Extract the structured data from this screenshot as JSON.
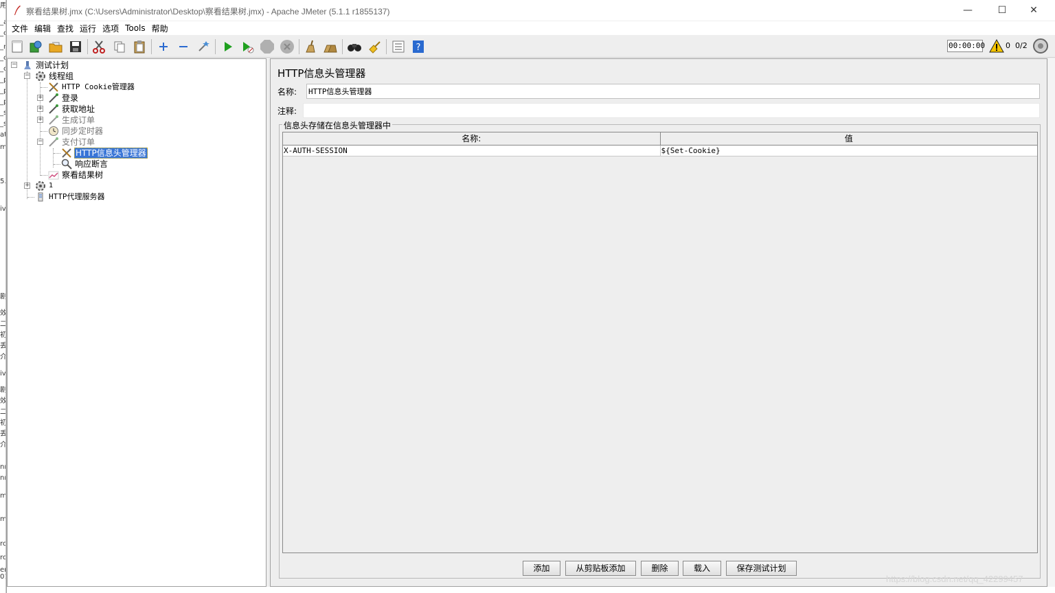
{
  "window": {
    "title": "察看结果树.jmx (C:\\Users\\Administrator\\Desktop\\察看结果树.jmx) - Apache JMeter (5.1.1 r1855137)",
    "minimize": "—",
    "maximize": "☐",
    "close": "✕"
  },
  "menu": [
    "文件",
    "编辑",
    "查找",
    "运行",
    "选项",
    "Tools",
    "帮助"
  ],
  "toolbar": {
    "timer": "00:00:00",
    "warnings": "0",
    "threads": "0/2"
  },
  "tree": {
    "test_plan": "测试计划",
    "thread_group": "线程组",
    "cookie_manager": "HTTP Cookie管理器",
    "login": "登录",
    "get_address": "获取地址",
    "create_order": "生成订单",
    "sync_timer": "同步定时器",
    "pay_order": "支付订单",
    "header_manager": "HTTP信息头管理器",
    "response_assertion": "响应断言",
    "view_results_tree": "察看结果树",
    "thread_group_1": "1",
    "http_proxy": "HTTP代理服务器"
  },
  "panel": {
    "title": "HTTP信息头管理器",
    "name_label": "名称:",
    "name_value": "HTTP信息头管理器",
    "comment_label": "注释:",
    "comment_value": "",
    "group_title": "信息头存储在信息头管理器中",
    "columns": [
      "名称:",
      "值"
    ],
    "rows": [
      {
        "name": "X-AUTH-SESSION",
        "value": "${Set-Cookie}"
      }
    ],
    "buttons": {
      "add": "添加",
      "add_clipboard": "从剪贴板添加",
      "delete": "删除",
      "load": "载入",
      "save_plan": "保存测试计划"
    }
  },
  "watermark": "https://blog.csdn.net/qq_42299457",
  "background_window_text": {
    "fragments": [
      "用",
      "_a",
      "_c",
      "_n",
      "_c",
      "_c",
      "_p",
      "_p",
      "_p",
      "_s",
      "_s",
      "at",
      "m",
      "5.",
      "iv",
      "剧",
      "效",
      "二",
      "初",
      "丢",
      "介",
      "iv",
      "剧",
      "效",
      "二",
      "初",
      "丢",
      "介",
      "nr",
      "nr",
      "m",
      "m",
      "rc",
      "rc",
      "er 01"
    ]
  }
}
